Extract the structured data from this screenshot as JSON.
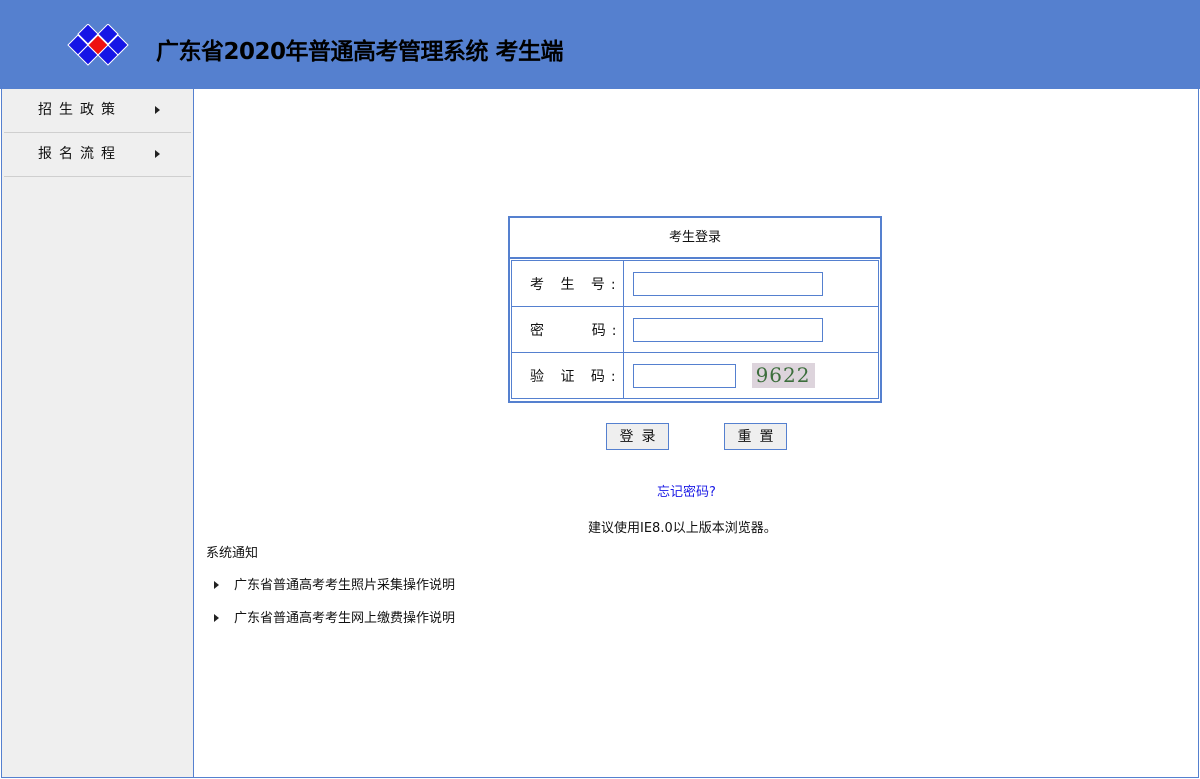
{
  "header": {
    "title": "广东省2020年普通高考管理系统  考生端"
  },
  "sidebar": {
    "items": [
      {
        "label": "招生政策"
      },
      {
        "label": "报名流程"
      }
    ]
  },
  "login": {
    "title": "考生登录",
    "fields": {
      "exam_no": "考 生 号:",
      "password": "密    码:",
      "captcha": "验 证 码:"
    },
    "captcha_text": "9622",
    "login_button": "登录",
    "reset_button": "重置"
  },
  "forgot": "忘记密码?",
  "tip": "建议使用IE8.0以上版本浏览器。",
  "notice": {
    "title": "系统通知",
    "items": [
      "广东省普通高考考生照片采集操作说明",
      "广东省普通高考考生网上缴费操作说明"
    ]
  }
}
